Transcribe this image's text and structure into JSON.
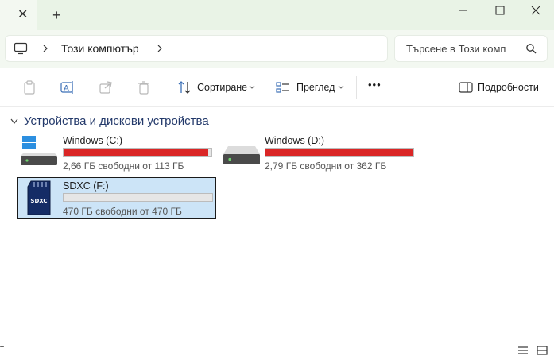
{
  "titlebar": {
    "close_glyph": "✕",
    "new_tab_glyph": "+",
    "minimize_glyph": "—",
    "close_window_glyph": "✕"
  },
  "address": {
    "location_icon": "computer-icon",
    "breadcrumb": "Този компютър",
    "search_placeholder": "Търсене в Този комп"
  },
  "toolbar": {
    "sort_label": "Сортиране",
    "view_label": "Преглед",
    "more_label": "•••",
    "details_label": "Подробности"
  },
  "section": {
    "title": "Устройства и дискови устройства"
  },
  "drives": [
    {
      "name": "Windows (C:)",
      "free_text": "2,66 ГБ свободни от 113 ГБ",
      "used_fraction": 0.976,
      "icon": "windows-drive-icon"
    },
    {
      "name": "Windows  (D:)",
      "free_text": "2,79 ГБ свободни от 362 ГБ",
      "used_fraction": 0.992,
      "icon": "hard-drive-icon"
    },
    {
      "name": "SDXC (F:)",
      "free_text": "470 ГБ свободни от 470 ГБ",
      "used_fraction": 0.0,
      "icon": "sd-card-icon",
      "sd_text": "SDXC"
    }
  ],
  "statusbar": {
    "left_text": "т"
  },
  "colors": {
    "accent_bar": "#da2626",
    "selection_bg": "#cce4f7",
    "titlebar_bg": "#e9f3e6"
  }
}
